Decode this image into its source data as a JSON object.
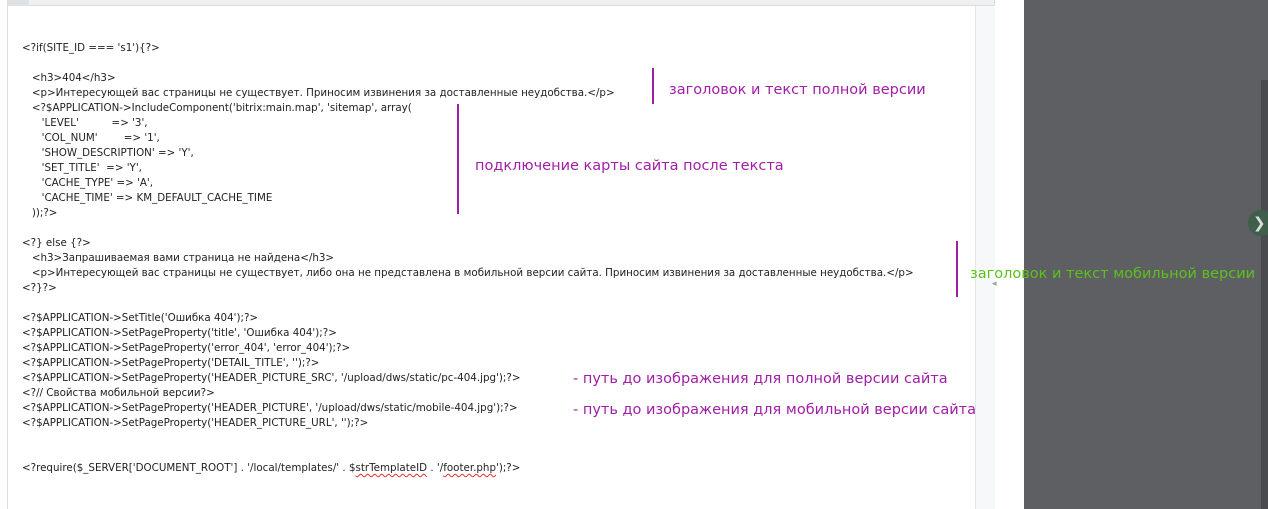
{
  "code": {
    "line_01": "<?if(SITE_ID === 's1'){?>",
    "line_02": "   <h3>404</h3>",
    "line_03": "   <p>Интересующей вас страницы не существует. Приносим извинения за доставленные неудобства.</p>",
    "line_04": "   <?$APPLICATION->IncludeComponent('bitrix:main.map', 'sitemap', array(",
    "line_05": "      'LEVEL'          => '3',",
    "line_06": "      'COL_NUM'        => '1',",
    "line_07": "      'SHOW_DESCRIPTION' => 'Y',",
    "line_08": "      'SET_TITLE'  => 'Y',",
    "line_09": "      'CACHE_TYPE' => 'A',",
    "line_10": "      'CACHE_TIME' => KM_DEFAULT_CACHE_TIME",
    "line_11": "   ));?>",
    "line_12": "<?} else {?>",
    "line_13": "   <h3>Запрашиваемая вами страница не найдена</h3>",
    "line_14": "   <p>Интересующей вас страницы не существует, либо она не представлена в мобильной версии сайта. Приносим извинения за доставленные неудобства.</p>",
    "line_15": "<?}?>",
    "line_16": "<?$APPLICATION->SetTitle('Ошибка 404');?>",
    "line_17": "<?$APPLICATION->SetPageProperty('title', 'Ошибка 404');?>",
    "line_18": "<?$APPLICATION->SetPageProperty('error_404', 'error_404');?>",
    "line_19": "<?$APPLICATION->SetPageProperty('DETAIL_TITLE', '');?>",
    "line_20": "<?$APPLICATION->SetPageProperty('HEADER_PICTURE_SRC', '/upload/dws/static/pc-404.jpg');?>",
    "line_21": "<?// Свойства мобильной версии?>",
    "line_22": "<?$APPLICATION->SetPageProperty('HEADER_PICTURE', '/upload/dws/static/mobile-404.jpg');?>",
    "line_23": "<?$APPLICATION->SetPageProperty('HEADER_PICTURE_URL', '');?>",
    "line_24_a": "<?require($_SERVER['DOCUMENT_ROOT'] . '/local/templates/' . $",
    "line_24_b": "strTemplateID",
    "line_24_c": " . '/",
    "line_24_d": "footer.php",
    "line_24_e": "');?>"
  },
  "annotations": {
    "full_header_text": "заголовок и текст полной версии",
    "sitemap_after_text": "подключение карты сайта после текста",
    "mobile_header_text": "заголовок и текст мобильной версии",
    "pc_image_path": "- путь до изображения для полной версии сайта",
    "mobile_image_path": "- путь до изображения для мобильной версии сайта"
  },
  "colors": {
    "annotation_purple": "#a01fa6",
    "annotation_green": "#5cc21a",
    "overlay": "#5e5f62"
  },
  "controls": {
    "scroll_arrow": "◂",
    "next_button": "❯"
  }
}
